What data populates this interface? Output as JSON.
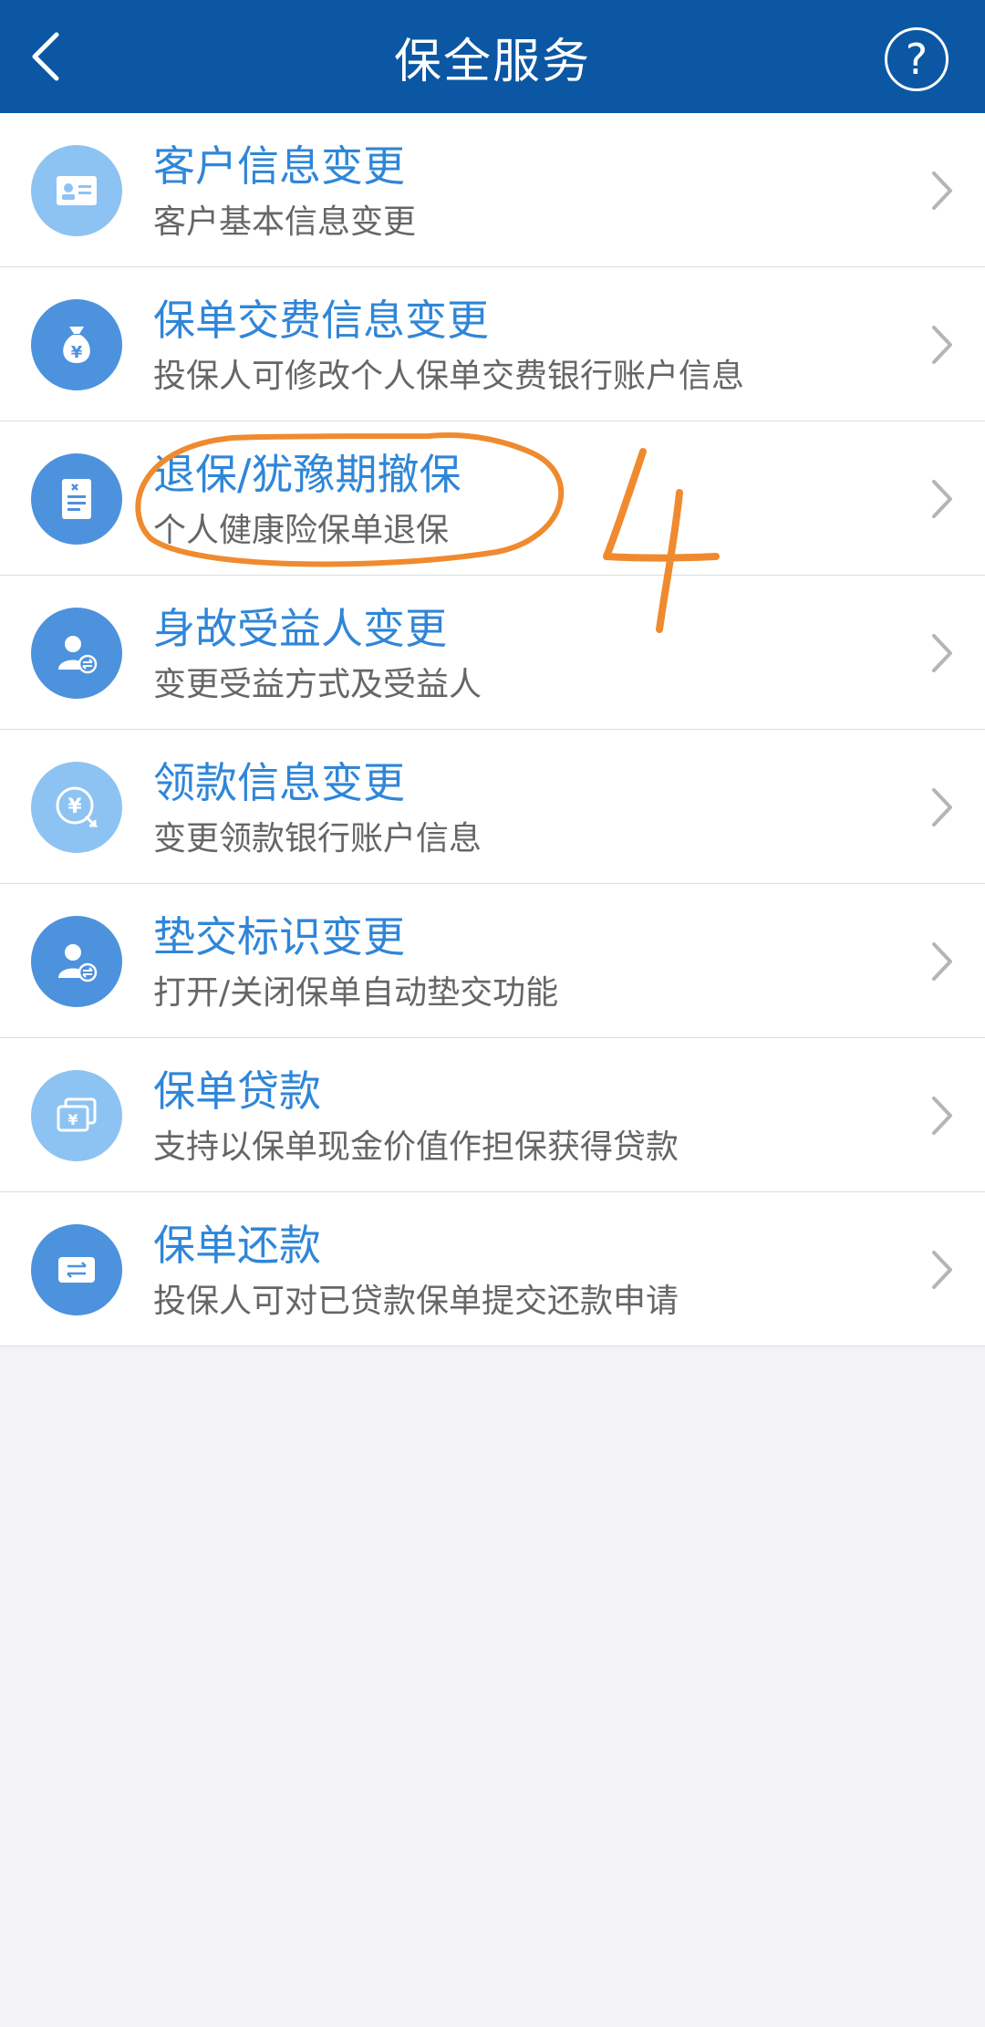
{
  "header": {
    "title": "保全服务",
    "back_icon": "chevron-left-icon",
    "help_label": "?"
  },
  "items": [
    {
      "title": "客户信息变更",
      "subtitle": "客户基本信息变更",
      "icon": "id-card-icon"
    },
    {
      "title": "保单交费信息变更",
      "subtitle": "投保人可修改个人保单交费银行账户信息",
      "icon": "money-bag-icon"
    },
    {
      "title": "退保/犹豫期撤保",
      "subtitle": "个人健康险保单退保",
      "icon": "document-icon"
    },
    {
      "title": "身故受益人变更",
      "subtitle": "变更受益方式及受益人",
      "icon": "person-exchange-icon"
    },
    {
      "title": "领款信息变更",
      "subtitle": "变更领款银行账户信息",
      "icon": "yen-coin-icon"
    },
    {
      "title": "垫交标识变更",
      "subtitle": "打开/关闭保单自动垫交功能",
      "icon": "person-exchange-icon"
    },
    {
      "title": "保单贷款",
      "subtitle": "支持以保单现金价值作担保获得贷款",
      "icon": "cash-cards-icon"
    },
    {
      "title": "保单还款",
      "subtitle": "投保人可对已贷款保单提交还款申请",
      "icon": "card-transfer-icon"
    }
  ],
  "annotation": {
    "number": "4",
    "color": "#f08a2e"
  },
  "colors": {
    "header_bg": "#0b57a4",
    "title_blue": "#2f86d8",
    "icon_light": "#8dc3f2",
    "icon_dark": "#4d92dd"
  }
}
